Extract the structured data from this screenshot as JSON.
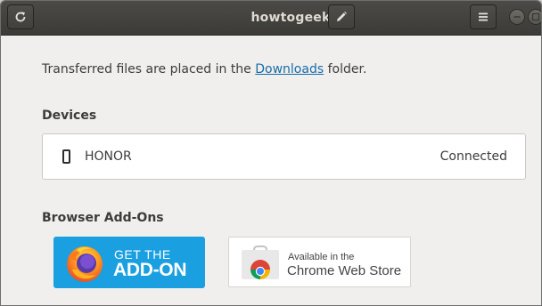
{
  "window": {
    "title": "howtogeek",
    "buttons": {
      "refresh_icon": "refresh-icon",
      "edit_icon": "pencil-icon",
      "menu_icon": "hamburger-menu-icon"
    }
  },
  "main": {
    "info_prefix": "Transferred files are placed in the ",
    "downloads_link": "Downloads",
    "info_suffix": " folder.",
    "devices_heading": "Devices",
    "devices": [
      {
        "icon": "phone-icon",
        "name": "HONOR",
        "status": "Connected"
      }
    ],
    "addons_heading": "Browser Add-Ons",
    "firefox_addon": {
      "line1": "GET THE",
      "line2": "ADD-ON",
      "color": "#1a9fe0"
    },
    "chrome_addon": {
      "line1": "Available in the",
      "line2": "Chrome Web Store"
    }
  },
  "colors": {
    "headerbar": "#3c3b37",
    "background": "#f1efed",
    "link": "#176ca8"
  }
}
